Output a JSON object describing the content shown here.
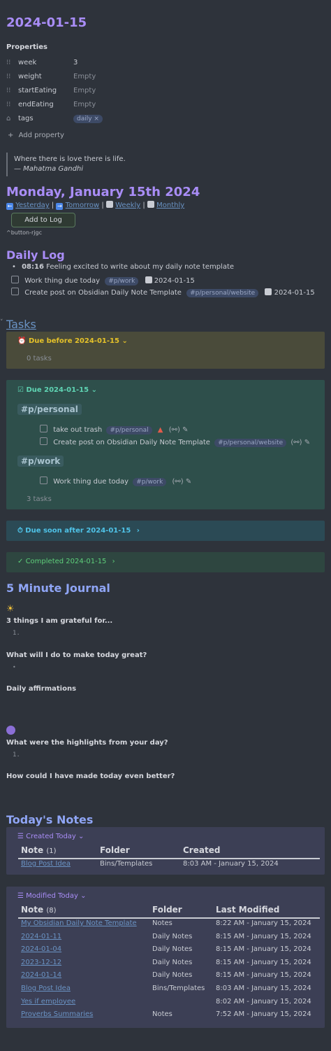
{
  "page": {
    "title": "2024-01-15"
  },
  "properties": {
    "heading": "Properties",
    "items": [
      {
        "key": "week",
        "value": "3"
      },
      {
        "key": "weight",
        "value": "Empty"
      },
      {
        "key": "startEating",
        "value": "Empty"
      },
      {
        "key": "endEating",
        "value": "Empty"
      },
      {
        "key": "tags",
        "value": "daily ×"
      }
    ],
    "add_label": "Add property"
  },
  "quote": {
    "text": "Where there is love there is life.",
    "author": "— Mahatma Gandhi"
  },
  "date_heading": "Monday, January 15th 2024",
  "nav": {
    "yesterday": "Yesterday",
    "tomorrow": "Tomorrow",
    "weekly": "Weekly",
    "monthly": "Monthly",
    "sep": "|"
  },
  "add_to_log": {
    "label": "Add to Log",
    "id": "^button-rjgc"
  },
  "daily_log": {
    "heading": "Daily Log",
    "bullet": {
      "time": "08:16",
      "text": "Feeling excited to write about my daily note template"
    },
    "tasks": [
      {
        "text": "Work thing due today",
        "tag": "#p/work",
        "date": "2024-01-15"
      },
      {
        "text": "Create post on Obsidian Daily Note Template",
        "tag": "#p/personal/website",
        "date": "2024-01-15"
      }
    ]
  },
  "tasks": {
    "heading": "Tasks",
    "due_before": {
      "title": "Due before 2024-01-15",
      "count": "0 tasks"
    },
    "due": {
      "title": "Due 2024-01-15",
      "groups": [
        {
          "name": "#p/personal",
          "items": [
            {
              "text": "take out trash",
              "tag": "#p/personal"
            },
            {
              "text": "Create post on Obsidian Daily Note Template",
              "tag": "#p/personal/website"
            }
          ]
        },
        {
          "name": "#p/work",
          "items": [
            {
              "text": "Work thing due today",
              "tag": "#p/work"
            }
          ]
        }
      ],
      "count": "3 tasks"
    },
    "due_soon": {
      "title": "Due soon after 2024-01-15"
    },
    "completed": {
      "title": "Completed 2024-01-15"
    }
  },
  "journal": {
    "heading": "5 Minute Journal",
    "q1": "3 things I am grateful for...",
    "q1_marker": "1.",
    "q2": "What will I do to make today great?",
    "q2_marker": "•",
    "q3": "Daily affirmations",
    "q4": "What were the highlights from your day?",
    "q4_marker": "1.",
    "q5": "How could I have made today even better?"
  },
  "todays_notes": {
    "heading": "Today's Notes",
    "created": {
      "title": "Created Today",
      "headers": {
        "note": "Note",
        "count": "(1)",
        "folder": "Folder",
        "created": "Created"
      },
      "rows": [
        {
          "note": "Blog Post Idea",
          "folder": "Bins/Templates",
          "time": "8:03 AM - January 15, 2024"
        }
      ]
    },
    "modified": {
      "title": "Modified Today",
      "headers": {
        "note": "Note",
        "count": "(8)",
        "folder": "Folder",
        "modified": "Last Modified"
      },
      "rows": [
        {
          "note": "My Obsidian Daily Note Template",
          "folder": "Notes",
          "time": "8:22 AM - January 15, 2024"
        },
        {
          "note": "2024-01-11",
          "folder": "Daily Notes",
          "time": "8:15 AM - January 15, 2024"
        },
        {
          "note": "2024-01-04",
          "folder": "Daily Notes",
          "time": "8:15 AM - January 15, 2024"
        },
        {
          "note": "2023-12-12",
          "folder": "Daily Notes",
          "time": "8:15 AM - January 15, 2024"
        },
        {
          "note": "2024-01-14",
          "folder": "Daily Notes",
          "time": "8:15 AM - January 15, 2024"
        },
        {
          "note": "Blog Post Idea",
          "folder": "Bins/Templates",
          "time": "8:03 AM - January 15, 2024"
        },
        {
          "note": "Yes if employee",
          "folder": "",
          "time": "8:02 AM - January 15, 2024"
        },
        {
          "note": "Proverbs Summaries",
          "folder": "Notes",
          "time": "7:52 AM - January 15, 2024"
        }
      ]
    }
  }
}
